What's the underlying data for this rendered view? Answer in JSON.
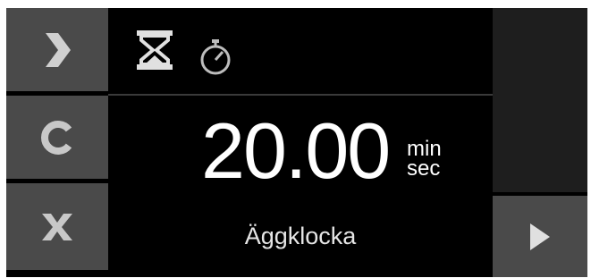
{
  "timer": {
    "value": "20.00",
    "unit_top": "min",
    "unit_bottom": "sec"
  },
  "program": {
    "name": "Äggklocka"
  },
  "modes": {
    "hourglass_icon": "hourglass-icon",
    "stopwatch_icon": "stopwatch-icon",
    "selected": "hourglass"
  },
  "left_buttons": [
    {
      "icon": "chevron-right-icon"
    },
    {
      "icon": "clear-icon"
    },
    {
      "icon": "close-icon"
    }
  ],
  "right_buttons": [
    {
      "icon": "play-icon"
    }
  ],
  "colors": {
    "background": "#000000",
    "button": "#4a4a4a",
    "icon": "#c8c8c8",
    "text": "#ffffff"
  }
}
